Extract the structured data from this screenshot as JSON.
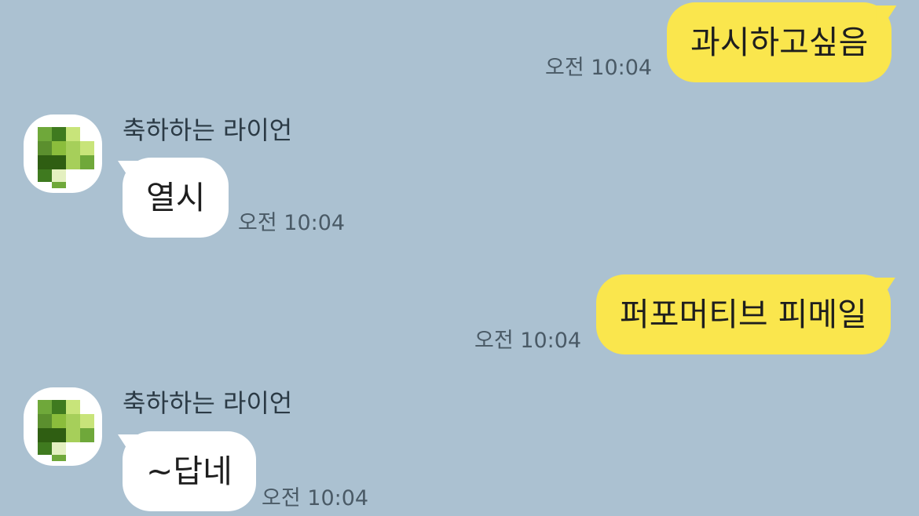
{
  "messages": [
    {
      "direction": "out",
      "text": "과시하고싶음",
      "time": "오전 10:04"
    },
    {
      "direction": "in",
      "sender": "축하하는 라이언",
      "text": "열시",
      "time": "오전 10:04",
      "avatar_icon": "pixelated-avatar-icon"
    },
    {
      "direction": "out",
      "text": "퍼포머티브 피메일",
      "time": "오전 10:04"
    },
    {
      "direction": "in",
      "sender": "축하하는 라이언",
      "text": "~답네",
      "time": "오전 10:04",
      "avatar_icon": "pixelated-avatar-icon"
    }
  ],
  "colors": {
    "background": "#abc1d1",
    "outgoing_bubble": "#fae64d",
    "incoming_bubble": "#ffffff",
    "avatar_greens": [
      "#5b8f2e",
      "#3f7a1f",
      "#8bbd3c",
      "#c8e47a",
      "#2f5e12",
      "#6fa83a",
      "#a6cf5a",
      "#e4f0c0"
    ]
  }
}
